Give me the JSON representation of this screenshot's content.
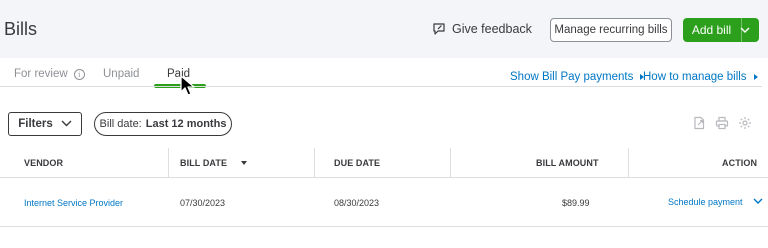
{
  "header": {
    "title": "Bills",
    "feedback_label": "Give feedback",
    "manage_recurring_label": "Manage recurring bills",
    "add_bill_label": "Add bill"
  },
  "tabs": [
    {
      "label": "For review",
      "icon": "info-icon"
    },
    {
      "label": "Unpaid"
    },
    {
      "label": "Paid",
      "active": true
    }
  ],
  "links": {
    "bill_pay": "Show Bill Pay payments",
    "how_to": "How to manage bills"
  },
  "filters": {
    "filters_label": "Filters",
    "date_chip_prefix": "Bill date:",
    "date_chip_value": "Last 12 months"
  },
  "toolbar_icons": [
    "export-icon",
    "print-icon",
    "settings-icon"
  ],
  "table": {
    "columns": [
      "VENDOR",
      "BILL DATE",
      "DUE DATE",
      "BILL AMOUNT",
      "ACTION"
    ],
    "rows": [
      {
        "vendor": "Internet Service Provider",
        "bill_date": "07/30/2023",
        "due_date": "08/30/2023",
        "amount": "$89.99",
        "action": "Schedule payment"
      }
    ]
  },
  "colors": {
    "accent_green": "#2ca01c",
    "link_blue": "#0077c5",
    "header_bg": "#f4f5f8",
    "text": "#393a3d"
  }
}
